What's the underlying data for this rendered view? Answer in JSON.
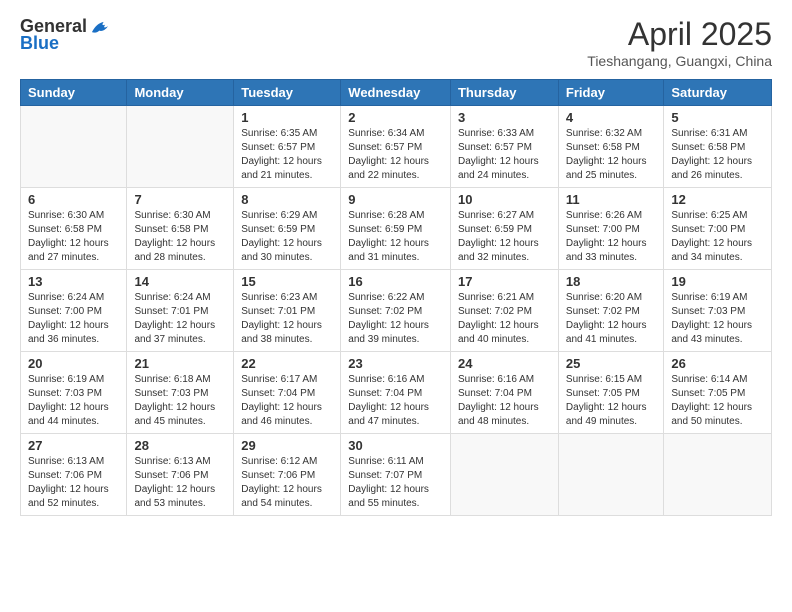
{
  "header": {
    "logo_general": "General",
    "logo_blue": "Blue",
    "month_title": "April 2025",
    "location": "Tieshangang, Guangxi, China"
  },
  "weekdays": [
    "Sunday",
    "Monday",
    "Tuesday",
    "Wednesday",
    "Thursday",
    "Friday",
    "Saturday"
  ],
  "weeks": [
    [
      {
        "day": "",
        "info": ""
      },
      {
        "day": "",
        "info": ""
      },
      {
        "day": "1",
        "info": "Sunrise: 6:35 AM\nSunset: 6:57 PM\nDaylight: 12 hours and 21 minutes."
      },
      {
        "day": "2",
        "info": "Sunrise: 6:34 AM\nSunset: 6:57 PM\nDaylight: 12 hours and 22 minutes."
      },
      {
        "day": "3",
        "info": "Sunrise: 6:33 AM\nSunset: 6:57 PM\nDaylight: 12 hours and 24 minutes."
      },
      {
        "day": "4",
        "info": "Sunrise: 6:32 AM\nSunset: 6:58 PM\nDaylight: 12 hours and 25 minutes."
      },
      {
        "day": "5",
        "info": "Sunrise: 6:31 AM\nSunset: 6:58 PM\nDaylight: 12 hours and 26 minutes."
      }
    ],
    [
      {
        "day": "6",
        "info": "Sunrise: 6:30 AM\nSunset: 6:58 PM\nDaylight: 12 hours and 27 minutes."
      },
      {
        "day": "7",
        "info": "Sunrise: 6:30 AM\nSunset: 6:58 PM\nDaylight: 12 hours and 28 minutes."
      },
      {
        "day": "8",
        "info": "Sunrise: 6:29 AM\nSunset: 6:59 PM\nDaylight: 12 hours and 30 minutes."
      },
      {
        "day": "9",
        "info": "Sunrise: 6:28 AM\nSunset: 6:59 PM\nDaylight: 12 hours and 31 minutes."
      },
      {
        "day": "10",
        "info": "Sunrise: 6:27 AM\nSunset: 6:59 PM\nDaylight: 12 hours and 32 minutes."
      },
      {
        "day": "11",
        "info": "Sunrise: 6:26 AM\nSunset: 7:00 PM\nDaylight: 12 hours and 33 minutes."
      },
      {
        "day": "12",
        "info": "Sunrise: 6:25 AM\nSunset: 7:00 PM\nDaylight: 12 hours and 34 minutes."
      }
    ],
    [
      {
        "day": "13",
        "info": "Sunrise: 6:24 AM\nSunset: 7:00 PM\nDaylight: 12 hours and 36 minutes."
      },
      {
        "day": "14",
        "info": "Sunrise: 6:24 AM\nSunset: 7:01 PM\nDaylight: 12 hours and 37 minutes."
      },
      {
        "day": "15",
        "info": "Sunrise: 6:23 AM\nSunset: 7:01 PM\nDaylight: 12 hours and 38 minutes."
      },
      {
        "day": "16",
        "info": "Sunrise: 6:22 AM\nSunset: 7:02 PM\nDaylight: 12 hours and 39 minutes."
      },
      {
        "day": "17",
        "info": "Sunrise: 6:21 AM\nSunset: 7:02 PM\nDaylight: 12 hours and 40 minutes."
      },
      {
        "day": "18",
        "info": "Sunrise: 6:20 AM\nSunset: 7:02 PM\nDaylight: 12 hours and 41 minutes."
      },
      {
        "day": "19",
        "info": "Sunrise: 6:19 AM\nSunset: 7:03 PM\nDaylight: 12 hours and 43 minutes."
      }
    ],
    [
      {
        "day": "20",
        "info": "Sunrise: 6:19 AM\nSunset: 7:03 PM\nDaylight: 12 hours and 44 minutes."
      },
      {
        "day": "21",
        "info": "Sunrise: 6:18 AM\nSunset: 7:03 PM\nDaylight: 12 hours and 45 minutes."
      },
      {
        "day": "22",
        "info": "Sunrise: 6:17 AM\nSunset: 7:04 PM\nDaylight: 12 hours and 46 minutes."
      },
      {
        "day": "23",
        "info": "Sunrise: 6:16 AM\nSunset: 7:04 PM\nDaylight: 12 hours and 47 minutes."
      },
      {
        "day": "24",
        "info": "Sunrise: 6:16 AM\nSunset: 7:04 PM\nDaylight: 12 hours and 48 minutes."
      },
      {
        "day": "25",
        "info": "Sunrise: 6:15 AM\nSunset: 7:05 PM\nDaylight: 12 hours and 49 minutes."
      },
      {
        "day": "26",
        "info": "Sunrise: 6:14 AM\nSunset: 7:05 PM\nDaylight: 12 hours and 50 minutes."
      }
    ],
    [
      {
        "day": "27",
        "info": "Sunrise: 6:13 AM\nSunset: 7:06 PM\nDaylight: 12 hours and 52 minutes."
      },
      {
        "day": "28",
        "info": "Sunrise: 6:13 AM\nSunset: 7:06 PM\nDaylight: 12 hours and 53 minutes."
      },
      {
        "day": "29",
        "info": "Sunrise: 6:12 AM\nSunset: 7:06 PM\nDaylight: 12 hours and 54 minutes."
      },
      {
        "day": "30",
        "info": "Sunrise: 6:11 AM\nSunset: 7:07 PM\nDaylight: 12 hours and 55 minutes."
      },
      {
        "day": "",
        "info": ""
      },
      {
        "day": "",
        "info": ""
      },
      {
        "day": "",
        "info": ""
      }
    ]
  ]
}
